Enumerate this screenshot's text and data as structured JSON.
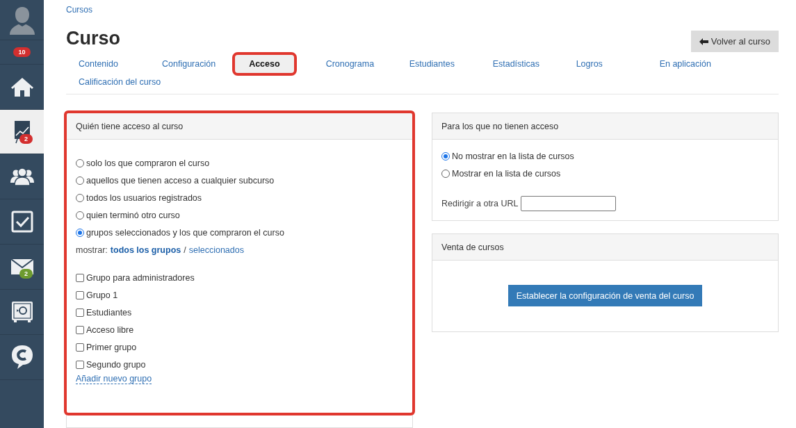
{
  "sidebar": {
    "items": [
      {
        "kind": "avatar",
        "selected": false
      },
      {
        "kind": "badge",
        "badge": "10",
        "color": "#d32f2f",
        "selected": false
      },
      {
        "kind": "home",
        "selected": false
      },
      {
        "kind": "chart",
        "badge": "2",
        "color": "#d32f2f",
        "selected": true
      },
      {
        "kind": "people",
        "selected": false
      },
      {
        "kind": "task",
        "selected": false
      },
      {
        "kind": "mail",
        "badge": "2",
        "color": "#6d9b2f",
        "selected": false
      },
      {
        "kind": "safe",
        "selected": false
      },
      {
        "kind": "chat",
        "selected": false
      }
    ]
  },
  "breadcrumb": "Cursos",
  "title": "Curso",
  "back_button": "Volver al curso",
  "tabs": [
    {
      "label": "Contenido",
      "selected": false,
      "highlighted": false
    },
    {
      "label": "Configuración",
      "selected": false,
      "highlighted": false
    },
    {
      "label": "Acceso",
      "selected": true,
      "highlighted": true
    },
    {
      "label": "Cronograma",
      "selected": false,
      "highlighted": false
    },
    {
      "label": "Estudiantes",
      "selected": false,
      "highlighted": false
    },
    {
      "label": "Estadísticas",
      "selected": false,
      "highlighted": false
    },
    {
      "label": "Logros",
      "selected": false,
      "highlighted": false
    },
    {
      "label": "En aplicación",
      "selected": false,
      "highlighted": false
    },
    {
      "label": "Calificación del curso",
      "selected": false,
      "highlighted": false
    }
  ],
  "access_panel": {
    "title": "Quién tiene acceso al curso",
    "highlighted": true,
    "options": [
      {
        "label": "solo los que compraron el curso",
        "selected": false
      },
      {
        "label": "aquellos que tienen acceso a cualquier subcurso",
        "selected": false
      },
      {
        "label": "todos los usuarios registrados",
        "selected": false
      },
      {
        "label": "quien terminó otro curso",
        "selected": false
      },
      {
        "label": "grupos seleccionados y los que compraron el curso",
        "selected": true
      }
    ],
    "show_label": "mostrar:",
    "show_filters": [
      {
        "label": "todos los grupos",
        "selected": true
      },
      {
        "label": "seleccionados",
        "selected": false
      }
    ],
    "separator": "/",
    "groups": [
      {
        "label": "Grupo para administradores",
        "checked": false
      },
      {
        "label": "Grupo 1",
        "checked": false
      },
      {
        "label": "Estudiantes",
        "checked": false
      },
      {
        "label": "Acceso libre",
        "checked": false
      },
      {
        "label": "Primer grupo",
        "checked": false
      },
      {
        "label": "Segundo grupo",
        "checked": false
      }
    ],
    "add_link": "Añadir nuevo grupo"
  },
  "no_access_panel": {
    "title": "Para los que no tienen acceso",
    "options": [
      {
        "label": "No mostrar en la lista de cursos",
        "selected": true
      },
      {
        "label": "Mostrar en la lista de cursos",
        "selected": false
      }
    ],
    "redirect_label": "Redirigir a otra URL"
  },
  "sales_panel": {
    "title": "Venta de cursos",
    "button": "Establecer la configuración de venta del curso"
  }
}
